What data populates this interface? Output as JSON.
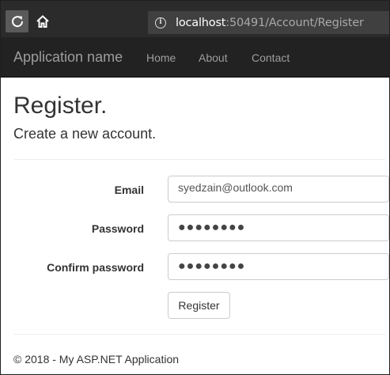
{
  "browser": {
    "url_host": "localhost",
    "url_rest": ":50491/Account/Register"
  },
  "navbar": {
    "brand": "Application name",
    "links": [
      "Home",
      "About",
      "Contact"
    ]
  },
  "page": {
    "title": "Register.",
    "subtitle": "Create a new account."
  },
  "form": {
    "email_label": "Email",
    "email_value": "syedzain@outlook.com",
    "password_label": "Password",
    "password_value": "●●●●●●●●",
    "confirm_label": "Confirm password",
    "confirm_value": "●●●●●●●●",
    "submit_label": "Register"
  },
  "footer": {
    "text": "© 2018 - My ASP.NET Application"
  },
  "icons": {
    "reload": "reload-icon",
    "home": "home-icon",
    "info": "info-icon"
  },
  "colors": {
    "browser_chrome": "#2b2b2b",
    "navbar": "#222222",
    "nav_text": "#9d9d9d"
  }
}
